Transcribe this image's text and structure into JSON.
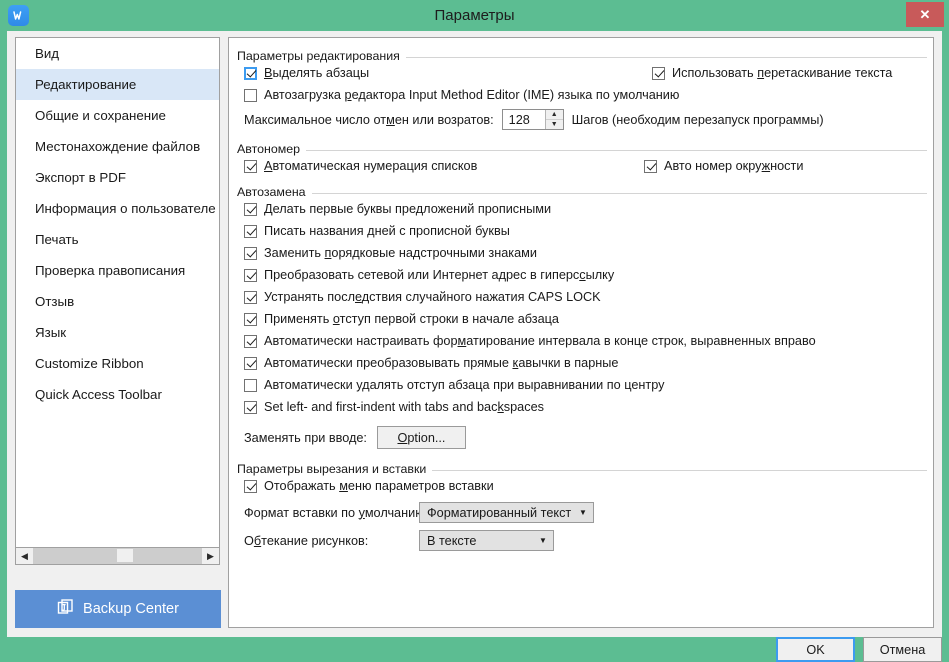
{
  "window": {
    "title": "Параметры",
    "app_icon": "word-document-icon",
    "close_label": "✕",
    "titlebar_color": "#5cbd92",
    "close_button_color": "#c85a5a"
  },
  "sidebar": {
    "items": [
      {
        "label": "Вид",
        "selected": false
      },
      {
        "label": "Редактирование",
        "selected": true
      },
      {
        "label": "Общие и сохранение",
        "selected": false
      },
      {
        "label": "Местонахождение файлов",
        "selected": false
      },
      {
        "label": "Экспорт в PDF",
        "selected": false
      },
      {
        "label": "Информация о пользователе",
        "selected": false
      },
      {
        "label": "Печать",
        "selected": false
      },
      {
        "label": "Проверка правописания",
        "selected": false
      },
      {
        "label": "Отзыв",
        "selected": false
      },
      {
        "label": "Язык",
        "selected": false
      },
      {
        "label": "Customize Ribbon",
        "selected": false
      },
      {
        "label": "Quick Access Toolbar",
        "selected": false
      }
    ],
    "scrollbar": {
      "left_arrow": "◀",
      "right_arrow": "▶"
    },
    "backup_center": {
      "label": "Backup Center",
      "icon": "backup-window-icon",
      "color": "#5b8fd4"
    }
  },
  "groups": {
    "editing": {
      "title": "Параметры редактирования",
      "checkboxes": [
        {
          "label_pre": "",
          "label_underline": "В",
          "label_post": "ыделять абзацы",
          "checked": true,
          "focused": true
        },
        {
          "label_pre": "Автозагрузка ",
          "label_underline": "р",
          "label_post": "едактора Input Method Editor (IME) языка по умолчанию",
          "checked": false,
          "focused": false
        },
        {
          "label_pre": "Использовать ",
          "label_underline": "п",
          "label_post": "еретаскивание текста",
          "checked": true,
          "focused": false
        }
      ],
      "undo_label_pre": "Максимальное число от",
      "undo_label_underline": "м",
      "undo_label_post": "ен или возратов:",
      "undo_value": "128",
      "undo_suffix": "Шагов (необходим перезапуск программы)",
      "spin_up": "▲",
      "spin_down": "▼"
    },
    "autonumber": {
      "title": "Автономер",
      "checkboxes": [
        {
          "label_pre": "",
          "label_underline": "А",
          "label_post": "втоматическая нумерация списков",
          "checked": true,
          "focused": false
        },
        {
          "label_pre": "Авто номер окру",
          "label_underline": "ж",
          "label_post": "ности",
          "checked": true,
          "focused": false
        }
      ]
    },
    "autocorrect": {
      "title": "Автозамена",
      "checkboxes": [
        {
          "label_pre": "Делать первые буквы пре",
          "label_underline": "д",
          "label_post": "ложений прописными",
          "checked": true,
          "focused": false
        },
        {
          "label_pre": "Писать названия ",
          "label_underline": "д",
          "label_post": "ней с прописной буквы",
          "checked": true,
          "focused": false
        },
        {
          "label_pre": "Заменить ",
          "label_underline": "п",
          "label_post": "орядковые надстрочными знаками",
          "checked": true,
          "focused": false
        },
        {
          "label_pre": "Преобразовать сетевой или Интернет адрес в гиперс",
          "label_underline": "с",
          "label_post": "ылку",
          "checked": true,
          "focused": false
        },
        {
          "label_pre": "Устранять посл",
          "label_underline": "е",
          "label_post": "дствия случайного нажатия CAPS LOCK",
          "checked": true,
          "focused": false
        },
        {
          "label_pre": "Применять ",
          "label_underline": "о",
          "label_post": "тступ первой строки в начале абзаца",
          "checked": true,
          "focused": false
        },
        {
          "label_pre": "Автоматически настраивать фор",
          "label_underline": "м",
          "label_post": "атирование интервала в конце строк, выравненных вправо",
          "checked": true,
          "focused": false
        },
        {
          "label_pre": "Автоматически преобразовывать прямые ",
          "label_underline": "к",
          "label_post": "авычки в парные",
          "checked": true,
          "focused": false
        },
        {
          "label_pre": "Автоматически у",
          "label_underline": "д",
          "label_post": "алять отступ абзаца при выравнивании по центру",
          "checked": false,
          "focused": false
        },
        {
          "label_pre": "Set left- and first-indent with tabs and bac",
          "label_underline": "k",
          "label_post": "spaces",
          "checked": true,
          "focused": false
        }
      ],
      "replace_label": "Заменять при вводе:",
      "option_button_underline": "O",
      "option_button_post": "ption..."
    },
    "cutpaste": {
      "title": "Параметры вырезания и вставки",
      "checkbox": {
        "label_pre": "Отображать ",
        "label_underline": "м",
        "label_post": "еню параметров вставки",
        "checked": true,
        "focused": false
      },
      "paste_format_label_pre": "Формат вставки по ",
      "paste_format_label_underline": "у",
      "paste_format_label_post": "молчанию:",
      "paste_format_value": "Форматированный текст",
      "wrap_label_pre": "О",
      "wrap_label_underline": "б",
      "wrap_label_post": "текание рисунков:",
      "wrap_value": "В тексте",
      "combo_arrow": "▼"
    }
  },
  "footer": {
    "ok_label": "OK",
    "cancel_label": "Отмена"
  }
}
